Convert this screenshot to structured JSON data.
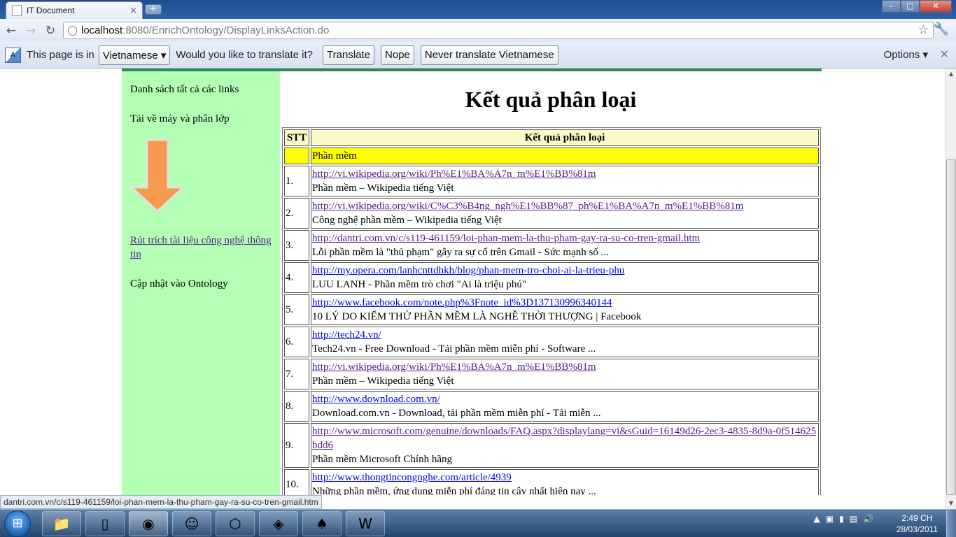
{
  "browser": {
    "tab_title": "IT Document",
    "tab_close": "×",
    "new_tab": "+",
    "url_host": "localhost",
    "url_path": ":8080/EnrichOntology/DisplayLinksAction.do",
    "status_url": "dantri.com.vn/c/s119-461159/loi-phan-mem-la-thu-pham-gay-ra-su-co-tren-gmail.htm"
  },
  "translate_bar": {
    "prefix": "This page is in",
    "language": "Vietnamese ▾",
    "question": "Would you like to translate it?",
    "translate": "Translate",
    "nope": "Nope",
    "never": "Never translate Vietnamese",
    "options": "Options ▾",
    "close": "✕"
  },
  "sidebar": {
    "items": [
      {
        "label": "Danh sách tất cả các links"
      },
      {
        "label": "Tải về máy và phân lớp"
      },
      {
        "label": "Rút trích tài liệu công nghệ thông tin"
      },
      {
        "label": "Cập nhật vào Ontology"
      }
    ]
  },
  "main": {
    "heading": "Kết quả phân loại",
    "table": {
      "headers": [
        "STT",
        "Kết quả phân loại"
      ],
      "category": "Phần mềm",
      "rows": [
        {
          "stt": "1.",
          "url": "http://vi.wikipedia.org/wiki/Ph%E1%BA%A7n_m%E1%BB%81m",
          "title": "Phần mềm – Wikipedia tiếng Việt"
        },
        {
          "stt": "2.",
          "url": "http://vi.wikipedia.org/wiki/C%C3%B4ng_ngh%E1%BB%87_ph%E1%BA%A7n_m%E1%BB%81m",
          "title": "Công nghệ phần mềm – Wikipedia tiếng Việt"
        },
        {
          "stt": "3.",
          "url": "http://dantri.com.vn/c/s119-461159/loi-phan-mem-la-thu-pham-gay-ra-su-co-tren-gmail.htm",
          "title": "Lỗi phần mềm là \"thủ phạm\" gây ra sự cố trên Gmail - Sức mạnh số ..."
        },
        {
          "stt": "4.",
          "url": "http://my.opera.com/lanhcnttdhkh/blog/phan-mem-tro-choi-ai-la-trieu-phu",
          "title": "LUU LANH - Phần mềm trò chơi \"Ai là triệu phú\""
        },
        {
          "stt": "5.",
          "url": "http://www.facebook.com/note.php%3Fnote_id%3D137130996340144",
          "title": "10 LÝ DO KIỂM THỬ PHẦN MỀM LÀ NGHỀ THỜI THƯỢNG | Facebook"
        },
        {
          "stt": "6.",
          "url": "http://tech24.vn/",
          "title": "Tech24.vn - Free Download - Tải phần mềm miễn phí - Software ..."
        },
        {
          "stt": "7.",
          "url": "http://vi.wikipedia.org/wiki/Ph%E1%BA%A7n_m%E1%BB%81m",
          "title": "Phần mềm – Wikipedia tiếng Việt"
        },
        {
          "stt": "8.",
          "url": "http://www.download.com.vn/",
          "title": "Download.com.vn - Download, tải phần mềm miễn phí - Tải miễn ..."
        },
        {
          "stt": "9.",
          "url": "http://www.microsoft.com/genuine/downloads/FAQ.aspx?displaylang=vi&sGuid=16149d26-2ec3-4835-8d9a-0f514625bdd6",
          "title": "Phần mềm Microsoft Chính hãng"
        },
        {
          "stt": "10.",
          "url": "http://www.thongtincongnghe.com/article/4939",
          "title": "Những phần mềm, ứng dụng miễn phí đáng tin cậy nhất hiện nay ..."
        }
      ]
    }
  },
  "taskbar": {
    "time": "2:49 CH",
    "date": "28/03/2011"
  },
  "colors": {
    "sidebar_bg": "#b3ffb3",
    "category_bg": "#ffff00",
    "header_bg": "#fff8c8",
    "visited_link": "#551a8b",
    "unvisited_link": "#0000ee"
  },
  "icons": {
    "arrow": "down-arrow-icon",
    "back": "back-arrow-icon",
    "forward": "forward-arrow-icon",
    "reload": "reload-icon",
    "star": "bookmark-star-icon",
    "wrench": "wrench-icon"
  }
}
